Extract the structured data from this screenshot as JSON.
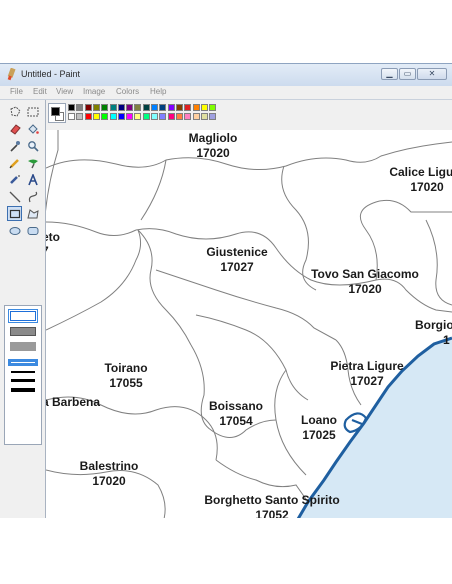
{
  "window": {
    "title": "Untitled - Paint"
  },
  "menu": [
    "File",
    "Edit",
    "View",
    "Image",
    "Colors",
    "Help"
  ],
  "toolbox": {
    "tools": [
      "free-form-select",
      "select",
      "eraser",
      "fill",
      "color-picker",
      "magnifier",
      "pencil",
      "brush",
      "airbrush",
      "text",
      "line",
      "curve",
      "rectangle",
      "polygon",
      "ellipse",
      "rounded-rectangle"
    ],
    "selected": "rectangle"
  },
  "palette": {
    "foreground": "#000000",
    "background": "#ffffff",
    "row1": [
      "#000000",
      "#808080",
      "#800000",
      "#808000",
      "#008000",
      "#008080",
      "#000080",
      "#800080",
      "#808040",
      "#004040",
      "#0080ff",
      "#004080",
      "#8000ff",
      "#804000",
      "#e02020",
      "#ff8000",
      "#ffff00",
      "#80ff00"
    ],
    "row2": [
      "#ffffff",
      "#c0c0c0",
      "#ff0000",
      "#ffff00",
      "#00ff00",
      "#00ffff",
      "#0000ff",
      "#ff00ff",
      "#ffff80",
      "#00ff80",
      "#80ffff",
      "#8080ff",
      "#ff0080",
      "#ff8040",
      "#ff80c0",
      "#ffd0a0",
      "#e0e0a0",
      "#a0a0e0"
    ]
  },
  "map": {
    "places": [
      {
        "name": "Magliolo",
        "cap": "17020"
      },
      {
        "name": "Calice Ligure",
        "cap": "17020"
      },
      {
        "name": "eto",
        "cap": "7"
      },
      {
        "name": "Giustenice",
        "cap": "17027"
      },
      {
        "name": "Tovo San Giacomo",
        "cap": "17020"
      },
      {
        "name": "Borgio",
        "cap": "1"
      },
      {
        "name": "Pietra Ligure",
        "cap": "17027"
      },
      {
        "name": "Toirano",
        "cap": "17055"
      },
      {
        "name": "a Barbena",
        "cap": ""
      },
      {
        "name": "Boissano",
        "cap": "17054"
      },
      {
        "name": "Loano",
        "cap": "17025"
      },
      {
        "name": "Balestrino",
        "cap": "17020"
      },
      {
        "name": "Borghetto Santo Spirito",
        "cap": "17052"
      }
    ],
    "colors": {
      "border": "#808080",
      "coast": "#1f5fa0",
      "sea": "#d6e8f5",
      "label": "#1a1a1a"
    }
  }
}
